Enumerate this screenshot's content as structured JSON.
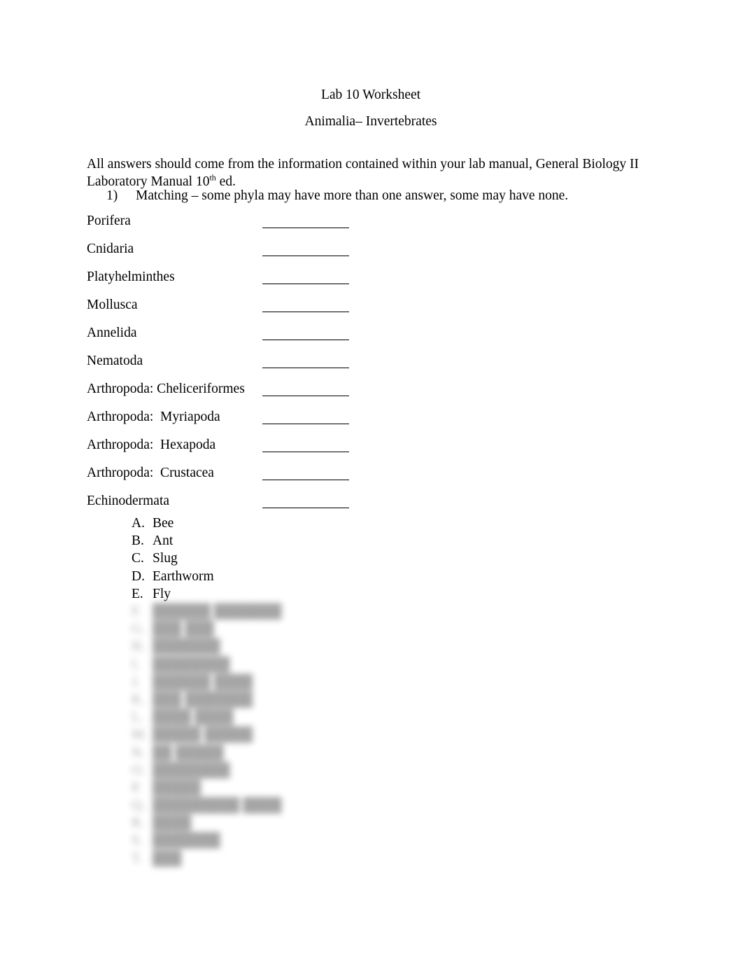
{
  "document": {
    "title": "Lab 10 Worksheet",
    "subtitle": "Animalia– Invertebrates",
    "intro_part1": "All answers should come from the information contained within your lab manual, General Biology II Laboratory Manual 10",
    "intro_superscript": "th",
    "intro_part2": " ed.",
    "background_color": "#ffffff",
    "text_color": "#000000"
  },
  "question1": {
    "number": "1)",
    "text": "Matching – some phyla may have more than one answer, some may have none."
  },
  "matching": {
    "rows": [
      {
        "phylum": "Porifera",
        "answer": ""
      },
      {
        "phylum": "Cnidaria",
        "answer": ""
      },
      {
        "phylum": "Platyhelminthes",
        "answer": ""
      },
      {
        "phylum": "Mollusca",
        "answer": ""
      },
      {
        "phylum": "Annelida",
        "answer": ""
      },
      {
        "phylum": "Nematoda",
        "answer": ""
      },
      {
        "phylum": "Arthropoda: Cheliceriformes",
        "answer": ""
      },
      {
        "phylum": "Arthropoda:  Myriapoda",
        "answer": ""
      },
      {
        "phylum": "Arthropoda:  Hexapoda",
        "answer": ""
      },
      {
        "phylum": "Arthropoda:  Crustacea",
        "answer": ""
      },
      {
        "phylum": "Echinodermata",
        "answer": ""
      }
    ]
  },
  "choices": {
    "visible": [
      {
        "marker": "A.",
        "label": "Bee"
      },
      {
        "marker": "B.",
        "label": "Ant"
      },
      {
        "marker": "C.",
        "label": "Slug"
      },
      {
        "marker": "D.",
        "label": "Earthworm"
      },
      {
        "marker": "E.",
        "label": "Fly"
      }
    ],
    "blurred_note": "remaining choices F. onward are blurred in the screenshot and not legible",
    "blurred": [
      {
        "marker": "F.",
        "label": "██████ ███████"
      },
      {
        "marker": "G.",
        "label": "███ ███"
      },
      {
        "marker": "H.",
        "label": "███████"
      },
      {
        "marker": "I.",
        "label": "████████"
      },
      {
        "marker": "J.",
        "label": "██████ ████"
      },
      {
        "marker": "K.",
        "label": "███ ███████"
      },
      {
        "marker": "L.",
        "label": "████ ████"
      },
      {
        "marker": "M.",
        "label": "█████ █████"
      },
      {
        "marker": "N.",
        "label": "██ █████"
      },
      {
        "marker": "O.",
        "label": "████████"
      },
      {
        "marker": "P.",
        "label": "█████"
      },
      {
        "marker": "Q.",
        "label": "█████████ ████"
      },
      {
        "marker": "R.",
        "label": "████"
      },
      {
        "marker": "S.",
        "label": "███████"
      },
      {
        "marker": "T.",
        "label": "███"
      }
    ]
  }
}
